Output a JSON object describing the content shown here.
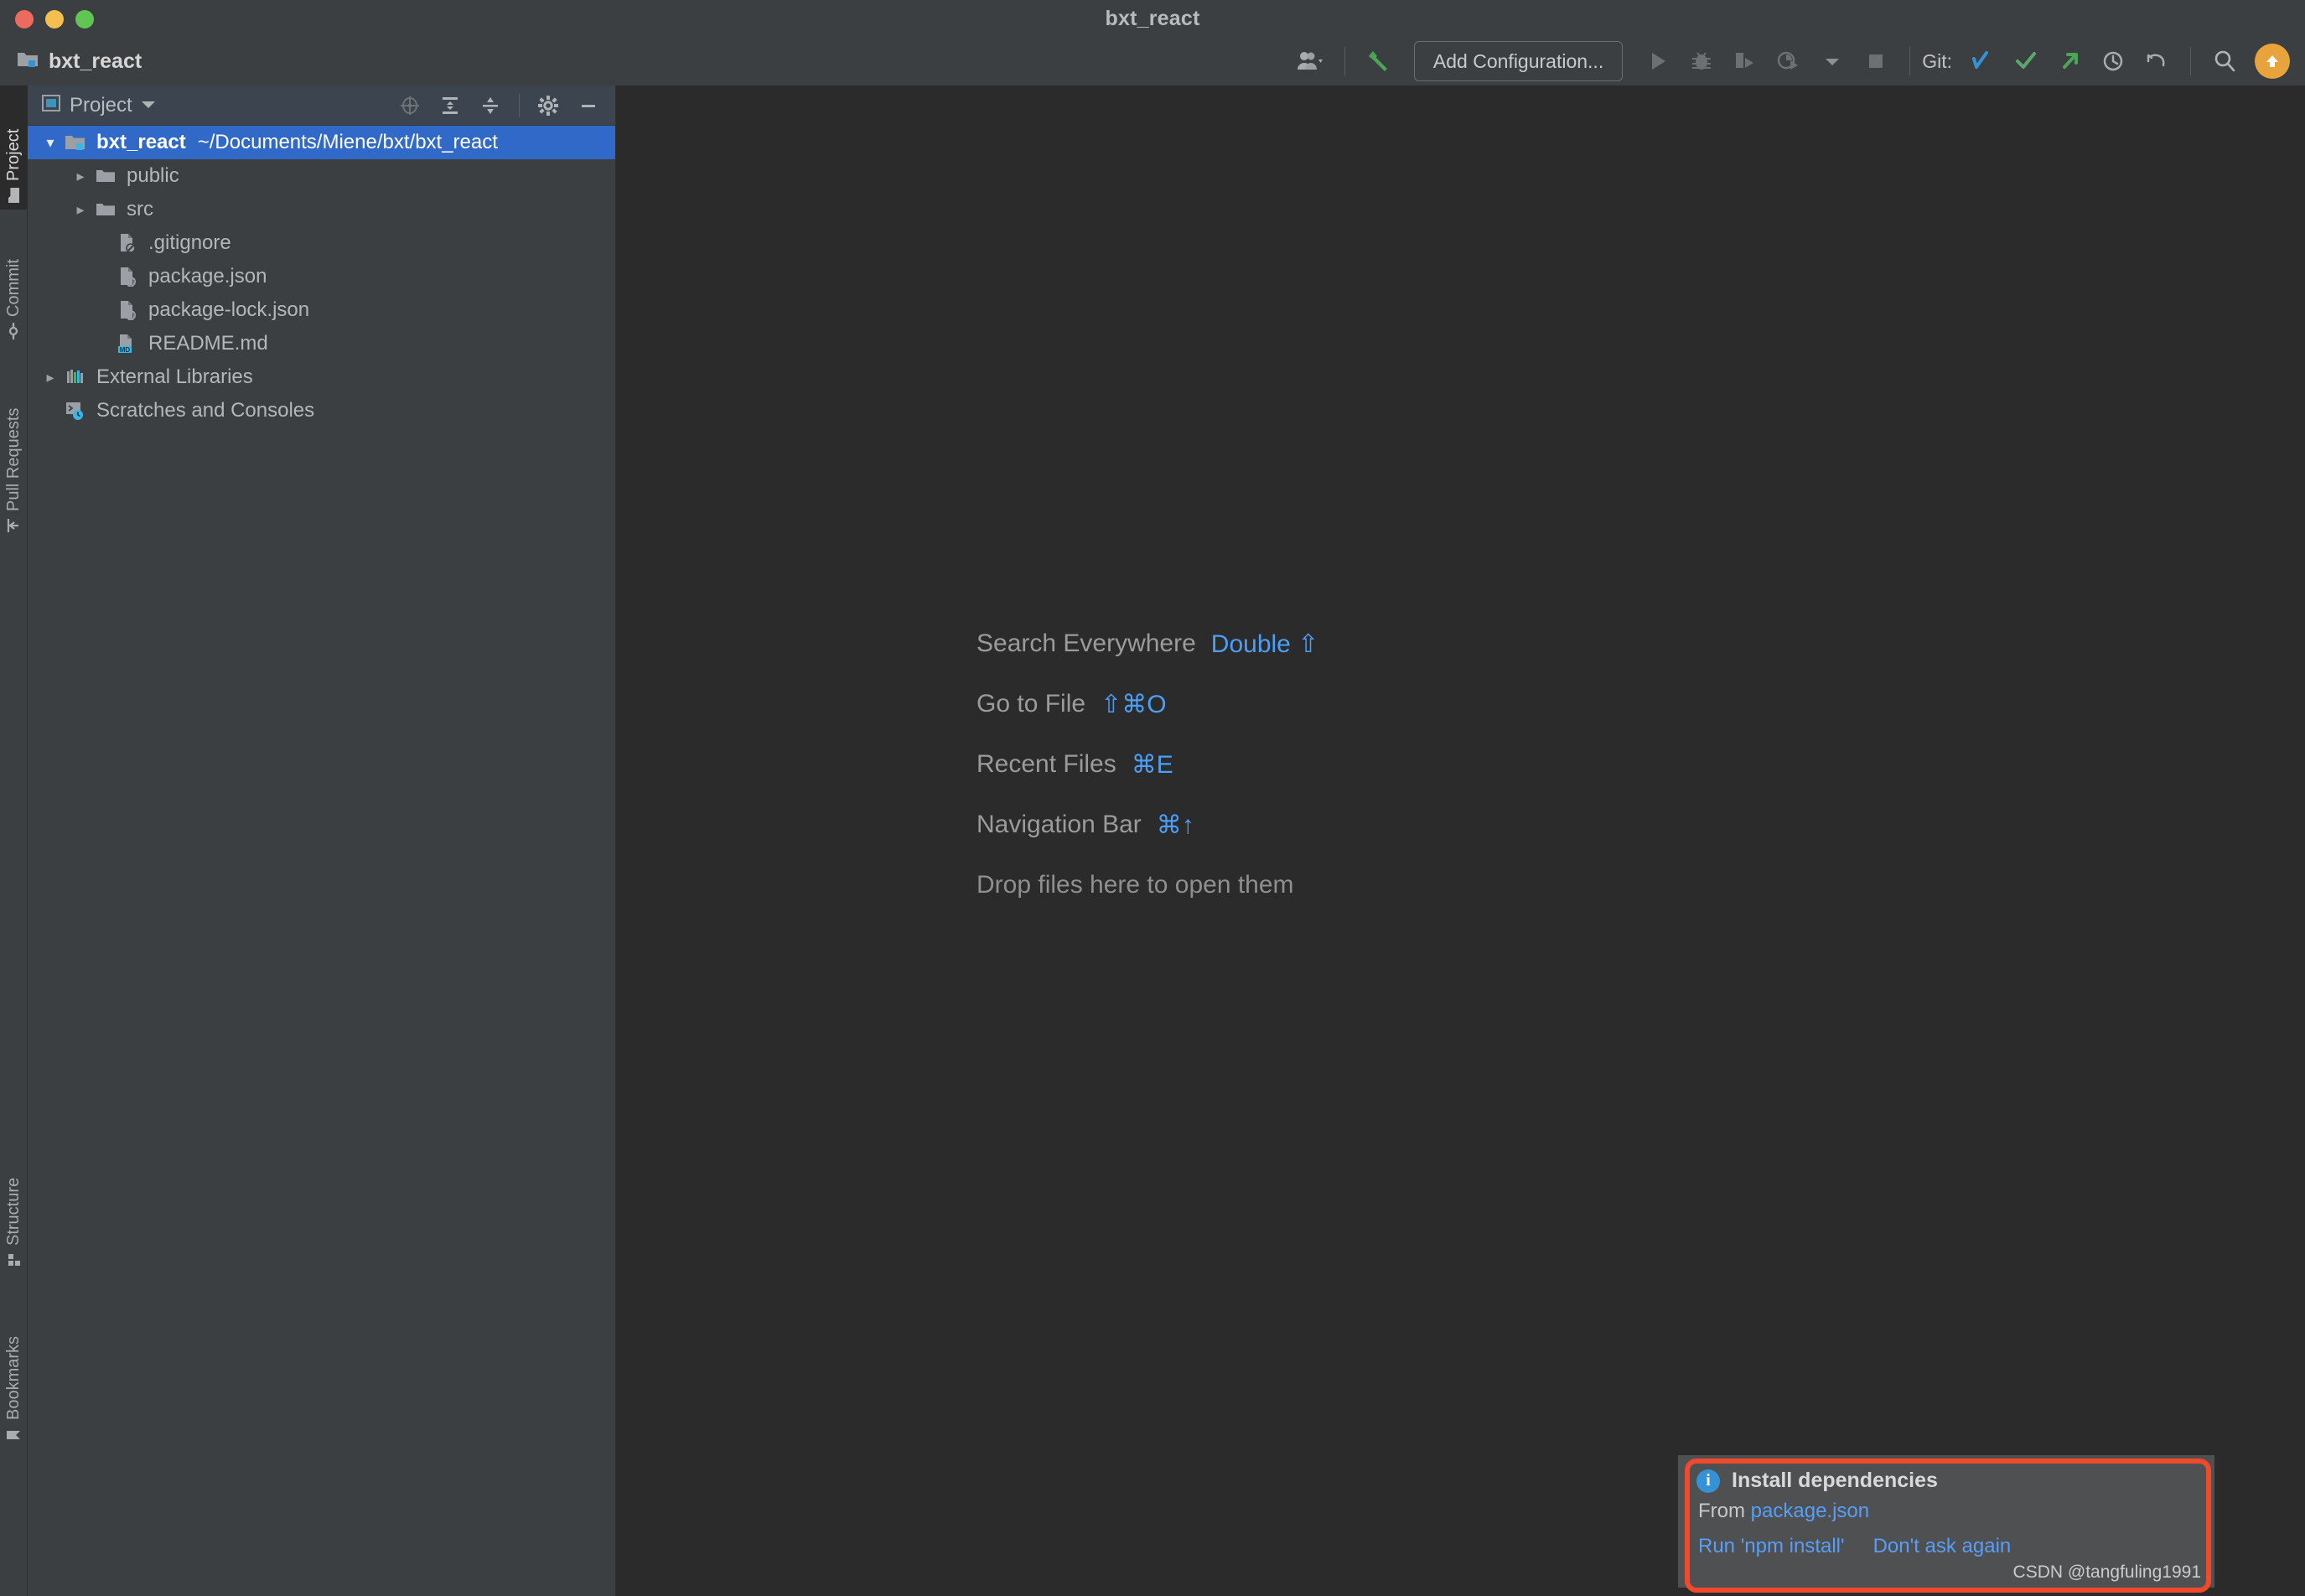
{
  "window": {
    "title": "bxt_react",
    "traffic_lights": [
      "close",
      "minimize",
      "zoom"
    ]
  },
  "toolbar": {
    "project_name": "bxt_react",
    "project_icon": "project-folder-icon",
    "avatar_icon": "users-icon",
    "build_icon": "hammer-icon",
    "add_configuration_label": "Add Configuration...",
    "run_icon": "run-icon",
    "debug_icon": "debug-bug-icon",
    "run_coverage_icon": "run-coverage-icon",
    "profile_icon": "profiler-icon",
    "profile_dropdown_icon": "chevron-down-icon",
    "stop_icon": "stop-icon",
    "git_label": "Git:",
    "git_update_icon": "git-update-project-icon",
    "git_commit_icon": "git-commit-check-icon",
    "git_push_icon": "git-push-arrow-icon",
    "git_history_icon": "history-clock-icon",
    "git_rollback_icon": "rollback-undo-icon",
    "search_icon": "search-icon",
    "update_badge_icon": "update-arrow-up-icon"
  },
  "left_strip": {
    "top_tabs": [
      {
        "label": "Project",
        "icon": "folder-icon",
        "active": true
      },
      {
        "label": "Commit",
        "icon": "commit-icon",
        "active": false
      },
      {
        "label": "Pull Requests",
        "icon": "pull-request-icon",
        "active": false
      }
    ],
    "bottom_tabs": [
      {
        "label": "Structure",
        "icon": "structure-icon",
        "active": false
      },
      {
        "label": "Bookmarks",
        "icon": "bookmark-icon",
        "active": false
      }
    ]
  },
  "project_panel": {
    "header": {
      "icon": "project-view-icon",
      "title": "Project",
      "dropdown_icon": "chevron-down-icon",
      "locate_icon": "scroll-from-source-icon",
      "expand_icon": "expand-all-icon",
      "collapse_icon": "collapse-all-icon",
      "settings_icon": "gear-icon",
      "hide_icon": "minimize-icon"
    },
    "tree": [
      {
        "name": "bxt_react",
        "path": "~/Documents/Miene/bxt/bxt_react",
        "icon": "project-root-folder-icon",
        "arrow": "expanded",
        "indent": 0,
        "selected": true,
        "bold": true
      },
      {
        "name": "public",
        "path": "",
        "icon": "folder-icon",
        "arrow": "collapsed",
        "indent": 1,
        "selected": false,
        "bold": false
      },
      {
        "name": "src",
        "path": "",
        "icon": "folder-icon",
        "arrow": "collapsed",
        "indent": 1,
        "selected": false,
        "bold": false
      },
      {
        "name": ".gitignore",
        "path": "",
        "icon": "gitignore-file-icon",
        "arrow": "none",
        "indent": 2,
        "selected": false,
        "bold": false
      },
      {
        "name": "package.json",
        "path": "",
        "icon": "json-file-icon",
        "arrow": "none",
        "indent": 2,
        "selected": false,
        "bold": false
      },
      {
        "name": "package-lock.json",
        "path": "",
        "icon": "json-file-icon",
        "arrow": "none",
        "indent": 2,
        "selected": false,
        "bold": false
      },
      {
        "name": "README.md",
        "path": "",
        "icon": "markdown-file-icon",
        "arrow": "none",
        "indent": 2,
        "selected": false,
        "bold": false
      },
      {
        "name": "External Libraries",
        "path": "",
        "icon": "libraries-icon",
        "arrow": "collapsed",
        "indent": 0,
        "selected": false,
        "bold": false
      },
      {
        "name": "Scratches and Consoles",
        "path": "",
        "icon": "scratches-console-icon",
        "arrow": "none",
        "indent": 0,
        "selected": false,
        "bold": false
      }
    ]
  },
  "editor": {
    "hints": [
      {
        "label": "Search Everywhere",
        "shortcut": "Double ⇧"
      },
      {
        "label": "Go to File",
        "shortcut": "⇧⌘O"
      },
      {
        "label": "Recent Files",
        "shortcut": "⌘E"
      },
      {
        "label": "Navigation Bar",
        "shortcut": "⌘↑"
      },
      {
        "label": "Drop files here to open them",
        "shortcut": ""
      }
    ]
  },
  "notification": {
    "info_icon": "info-icon",
    "info_glyph": "i",
    "title": "Install dependencies",
    "from_prefix": "From ",
    "from_link": "package.json",
    "actions": [
      {
        "label": "Run 'npm install'"
      },
      {
        "label": "Don't ask again"
      }
    ],
    "highlight_color": "#f0492c"
  },
  "watermark": {
    "text": "CSDN @tangfuling1991"
  },
  "colors": {
    "editor_bg": "#2b2b2b",
    "panel_bg": "#3c3f41",
    "panel_header_bg": "#3c4450",
    "selection_blue": "#3169c8",
    "link_blue": "#589df6",
    "accent_orange": "#e8a33d",
    "highlight_red": "#f0492c"
  }
}
